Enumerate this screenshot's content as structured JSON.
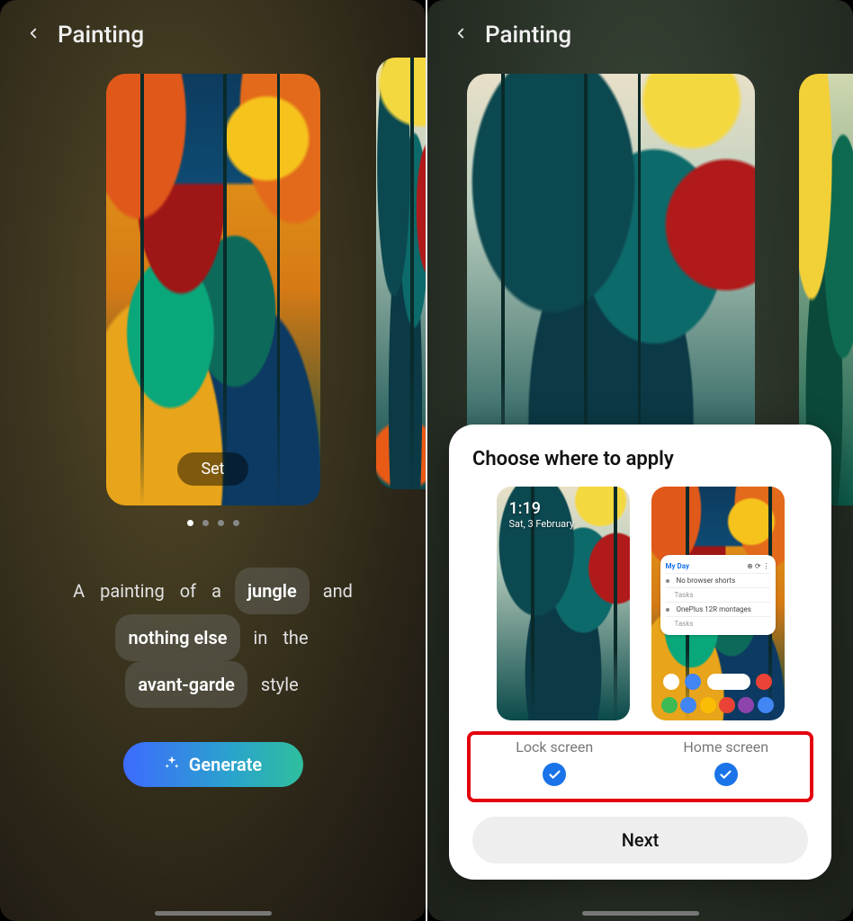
{
  "left": {
    "title": "Painting",
    "set_label": "Set",
    "page_dots": 4,
    "active_dot": 0,
    "prompt": {
      "p1": "A",
      "p2": "painting",
      "p3": "of",
      "p4": "a",
      "chip1": "jungle",
      "p5": "and",
      "chip2": "nothing else",
      "p6": "in",
      "p7": "the",
      "chip3": "avant-garde",
      "p8": "style"
    },
    "generate_label": "Generate"
  },
  "right": {
    "title": "Painting",
    "sheet": {
      "heading": "Choose where to apply",
      "lock": {
        "label": "Lock screen",
        "time": "1:19",
        "date": "Sat, 3 February",
        "checked": true
      },
      "home": {
        "label": "Home screen",
        "widget_title": "My Day",
        "widget_item1": "No browser shorts",
        "widget_sub1": "Tasks",
        "widget_item2": "OnePlus 12R montages",
        "widget_sub2": "Tasks",
        "checked": true
      },
      "next_label": "Next"
    }
  }
}
